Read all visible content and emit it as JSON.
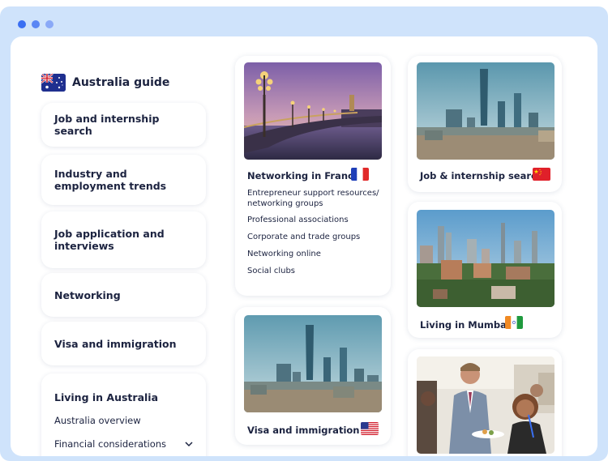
{
  "sidebar": {
    "guide_title": "Australia guide",
    "items": [
      {
        "label": "Job and internship search"
      },
      {
        "label": "Industry and employment trends"
      },
      {
        "label": "Job application and interviews"
      },
      {
        "label": "Networking"
      },
      {
        "label": "Visa and immigration"
      }
    ],
    "living": {
      "title": "Living in Australia",
      "subitems": [
        {
          "label": "Australia overview"
        },
        {
          "label": "Financial considerations"
        }
      ]
    }
  },
  "cards": {
    "france": {
      "title": "Networking in France",
      "flag": "france-flag",
      "links": [
        "Entrepreneur support resources/ networking groups",
        "Professional associations",
        "Corporate and trade groups",
        "Networking online",
        "Social clubs"
      ]
    },
    "china_jobs": {
      "title": "Job & internship search",
      "flag": "china-flag"
    },
    "mumbai": {
      "title": "Living in Mumbai",
      "flag": "india-flag"
    },
    "usa_visa": {
      "title": "Visa and immigration",
      "flag": "usa-flag"
    }
  },
  "colors": {
    "frame": "#cfe3fb",
    "text": "#1c2340",
    "dot_blue": "#3a6ff2"
  }
}
